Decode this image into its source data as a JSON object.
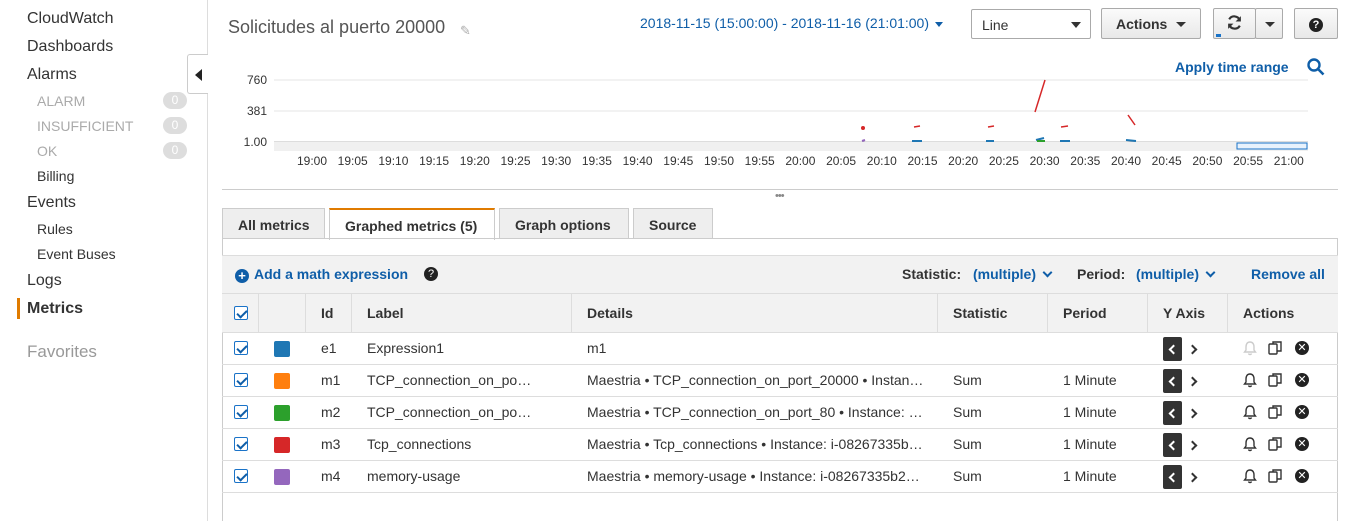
{
  "sidebar": {
    "cloudwatch": "CloudWatch",
    "dashboards": "Dashboards",
    "alarms": "Alarms",
    "alarm_items": [
      {
        "label": "ALARM",
        "count": "0"
      },
      {
        "label": "INSUFFICIENT",
        "count": "0"
      },
      {
        "label": "OK",
        "count": "0"
      }
    ],
    "billing": "Billing",
    "events": "Events",
    "rules": "Rules",
    "event_buses": "Event Buses",
    "logs": "Logs",
    "metrics": "Metrics",
    "favorites": "Favorites"
  },
  "header": {
    "title": "Solicitudes al puerto 20000",
    "time_range": "2018-11-15 (15:00:00) - 2018-11-16 (21:01:00)",
    "graph_type": "Line",
    "actions_label": "Actions",
    "apply_time_range": "Apply time range"
  },
  "chart_data": {
    "type": "line",
    "y_ticks": [
      "760",
      "381",
      "1.00"
    ],
    "x_ticks": [
      "19:00",
      "19:05",
      "19:10",
      "19:15",
      "19:20",
      "19:25",
      "19:30",
      "19:35",
      "19:40",
      "19:45",
      "19:50",
      "19:55",
      "20:00",
      "20:05",
      "20:10",
      "20:15",
      "20:20",
      "20:25",
      "20:30",
      "20:35",
      "20:40",
      "20:45",
      "20:50",
      "20:55",
      "21:00"
    ],
    "series_colors": [
      "#1f77b4",
      "#ff7f0e",
      "#2ca02c",
      "#d62728",
      "#9467bd"
    ]
  },
  "tabs": [
    "All metrics",
    "Graphed metrics (5)",
    "Graph options",
    "Source"
  ],
  "toolbar": {
    "add_math": "Add a math expression",
    "statistic_label": "Statistic:",
    "statistic_value": "(multiple)",
    "period_label": "Period:",
    "period_value": "(multiple)",
    "remove_all": "Remove all"
  },
  "table": {
    "headers": {
      "id": "Id",
      "label": "Label",
      "details": "Details",
      "statistic": "Statistic",
      "period": "Period",
      "yaxis": "Y Axis",
      "actions": "Actions"
    },
    "rows": [
      {
        "id": "e1",
        "color": "#1f77b4",
        "label": "Expression1",
        "details": "m1",
        "statistic": "",
        "period": "",
        "alarm_disabled": true
      },
      {
        "id": "m1",
        "color": "#ff7f0e",
        "label": "TCP_connection_on_po…",
        "details": "Maestria • TCP_connection_on_port_20000 • Instan…",
        "statistic": "Sum",
        "period": "1 Minute",
        "alarm_disabled": false
      },
      {
        "id": "m2",
        "color": "#2ca02c",
        "label": "TCP_connection_on_po…",
        "details": "Maestria • TCP_connection_on_port_80 • Instance: …",
        "statistic": "Sum",
        "period": "1 Minute",
        "alarm_disabled": false
      },
      {
        "id": "m3",
        "color": "#d62728",
        "label": "Tcp_connections",
        "details": "Maestria • Tcp_connections • Instance: i-08267335b…",
        "statistic": "Sum",
        "period": "1 Minute",
        "alarm_disabled": false
      },
      {
        "id": "m4",
        "color": "#9467bd",
        "label": "memory-usage",
        "details": "Maestria • memory-usage • Instance: i-08267335b2…",
        "statistic": "Sum",
        "period": "1 Minute",
        "alarm_disabled": false
      }
    ]
  }
}
